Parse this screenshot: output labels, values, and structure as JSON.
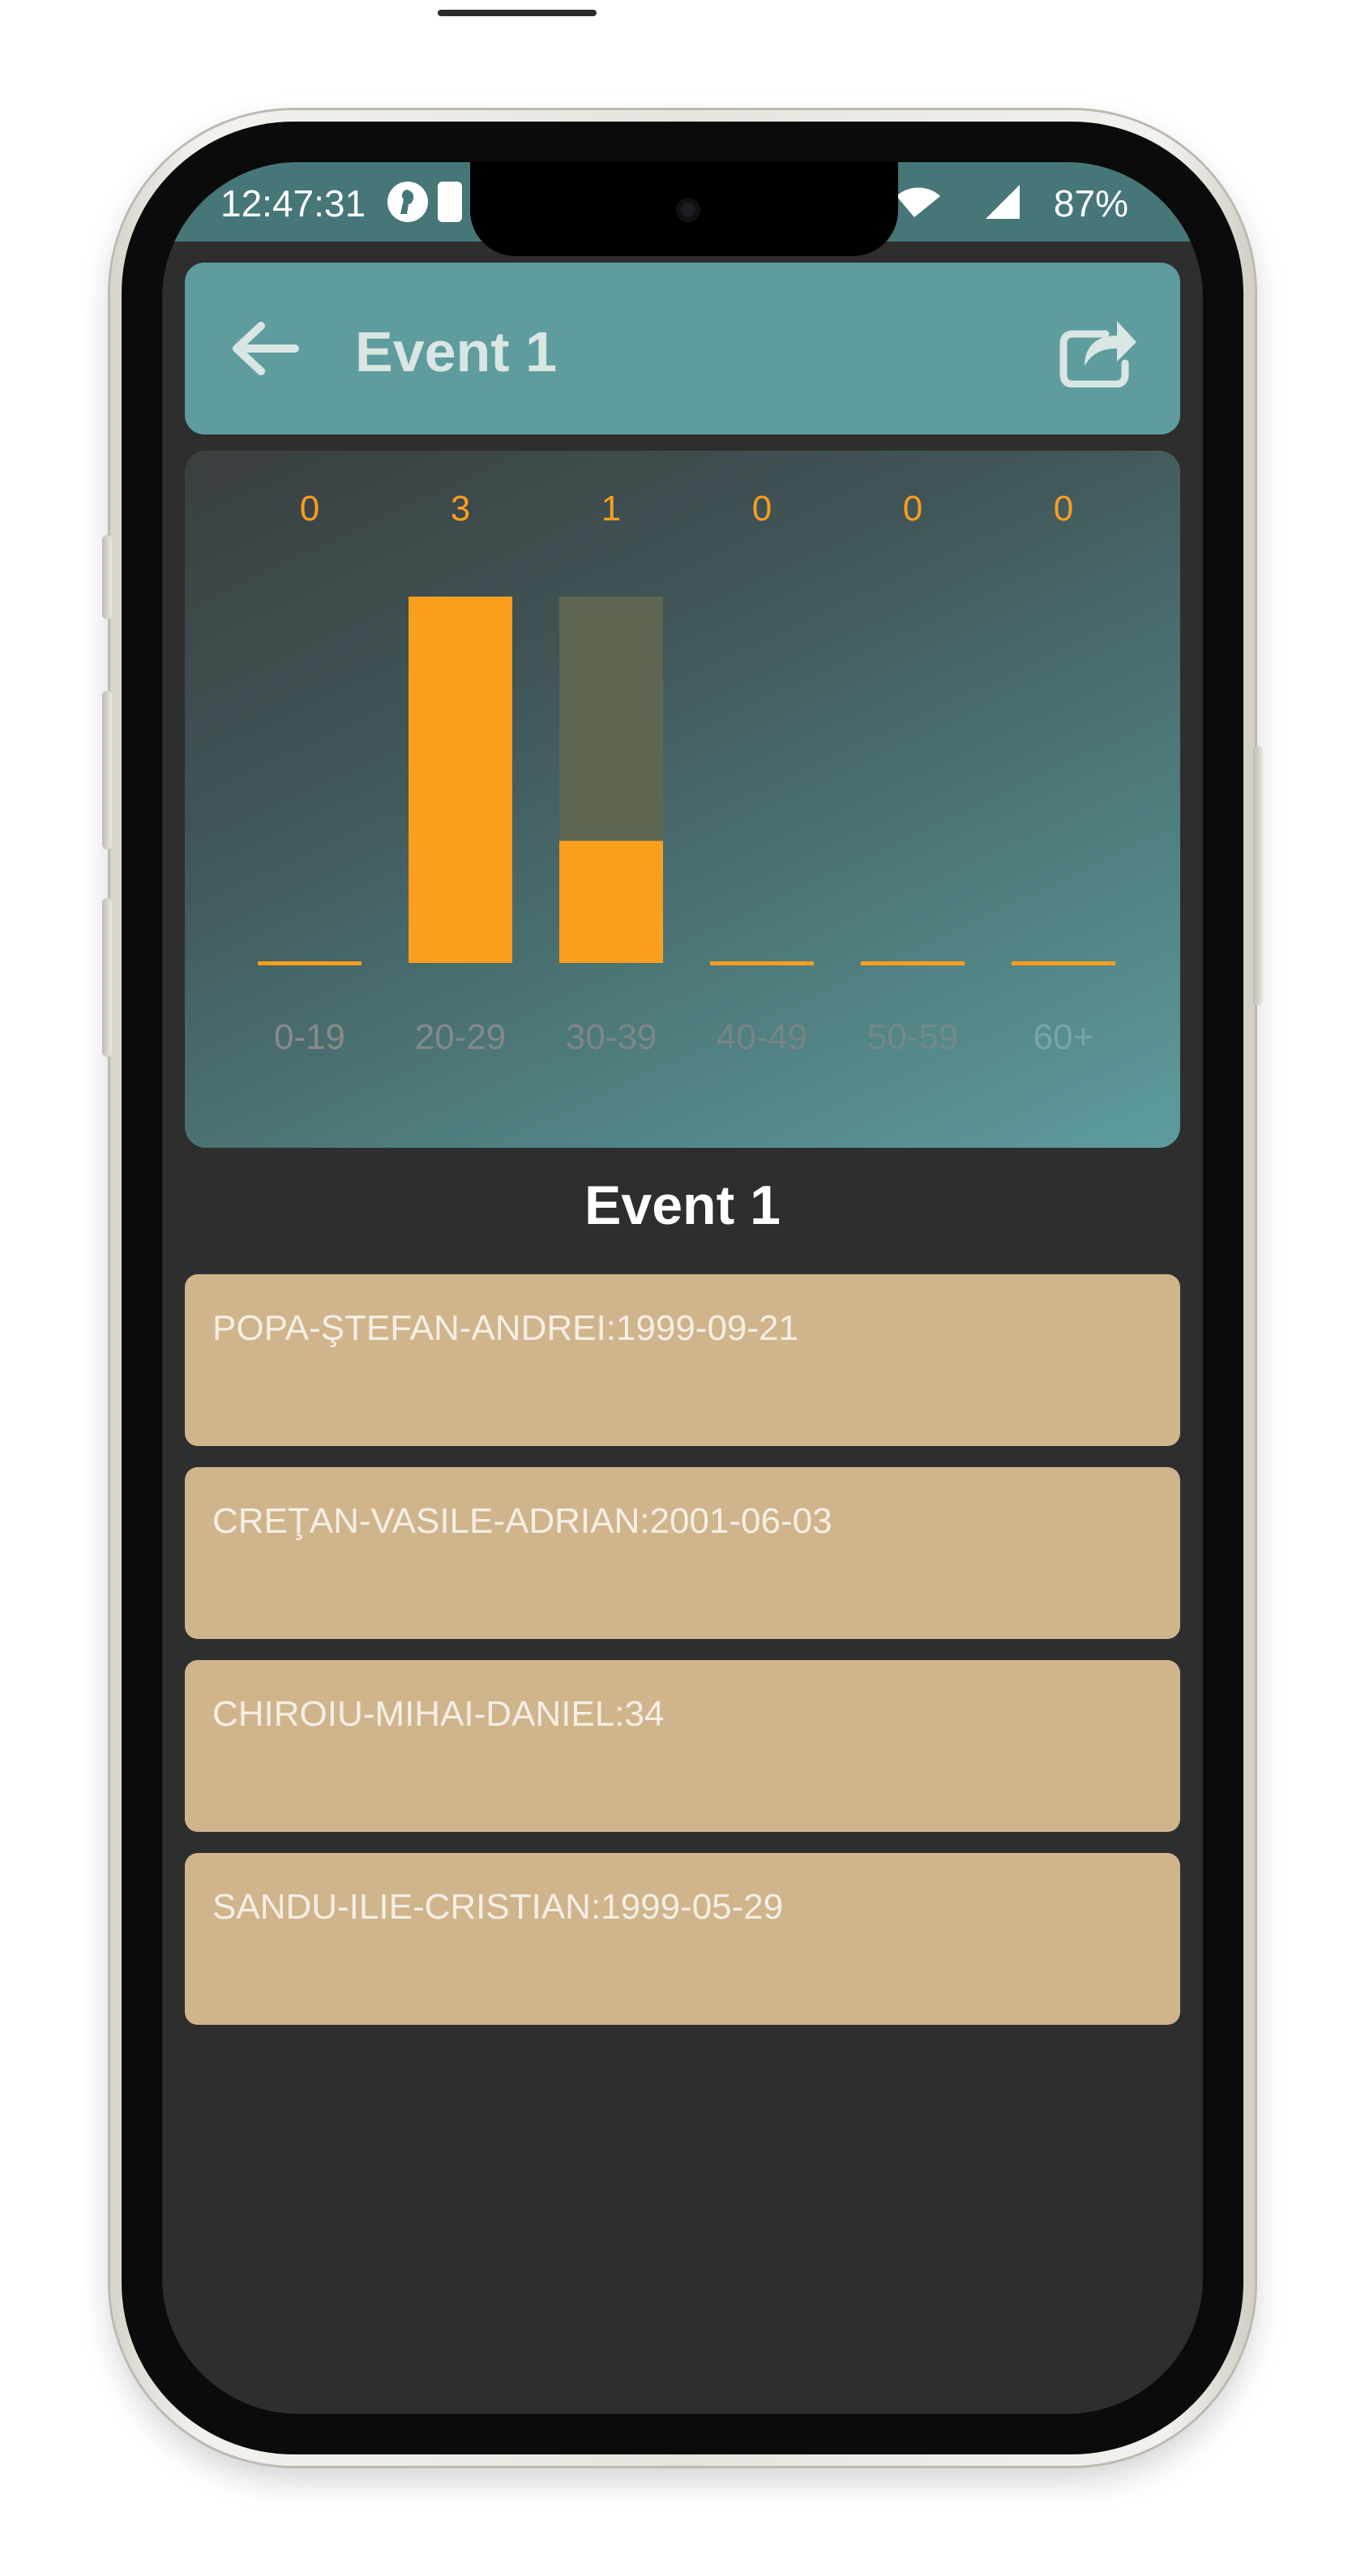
{
  "status_bar": {
    "time": "12:47:31",
    "battery": "87%",
    "icons": [
      "app-icon",
      "teams-icon",
      "bell-off-icon",
      "wifi-icon",
      "signal-icon"
    ]
  },
  "app_bar": {
    "title": "Event 1",
    "back_icon": "arrow-left-icon",
    "share_icon": "share-icon",
    "background": "#5e9c9e"
  },
  "chart_data": {
    "type": "bar",
    "categories": [
      "0-19",
      "20-29",
      "30-39",
      "40-49",
      "50-59",
      "60+"
    ],
    "values": [
      0,
      3,
      1,
      0,
      0,
      0
    ],
    "data_labels": [
      "0",
      "3",
      "1",
      "0",
      "0",
      "0"
    ],
    "ylim": [
      0,
      3
    ],
    "bar_color": "#fa9e1e",
    "track_color": "#5c6650",
    "label_color": "#fa9e1e",
    "grid": false,
    "legend": "none"
  },
  "section": {
    "title": "Event 1"
  },
  "participants": [
    "POPA-ŞTEFAN-ANDREI:1999-09-21",
    "CREŢAN-VASILE-ADRIAN:2001-06-03",
    "CHIROIU-MIHAI-DANIEL:34",
    "SANDU-ILIE-CRISTIAN:1999-05-29"
  ],
  "colors": {
    "screen_background": "#2e2e2e",
    "status_bar": "#467678",
    "list_item": "#d0b48c",
    "accent": "#fa9e1e"
  }
}
